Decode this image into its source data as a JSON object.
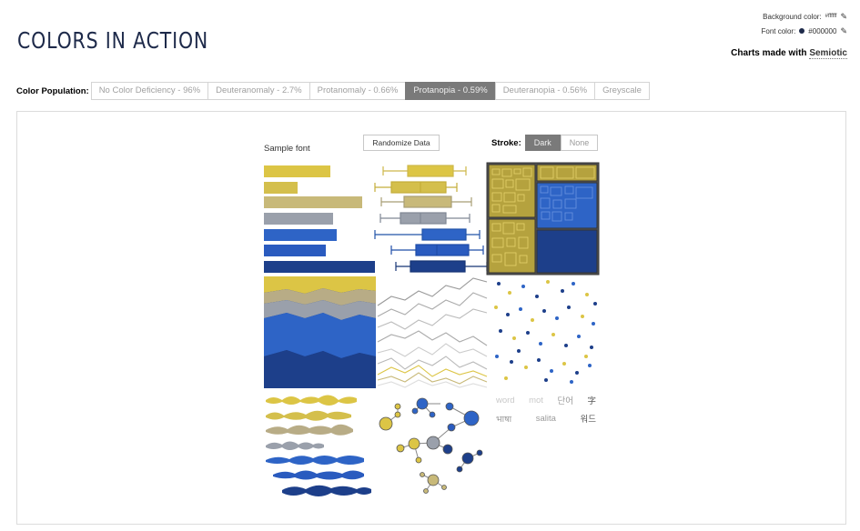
{
  "header": {
    "title": "COLORS IN ACTION",
    "background_color_label": "Background color:",
    "background_color_value": "#ffffff",
    "font_color_label": "Font color:",
    "font_color_value": "#000000",
    "made_with_prefix": "Charts made with",
    "made_with_link": "Semiotic"
  },
  "population": {
    "label": "Color Population:",
    "options": [
      {
        "label": "No Color Deficiency - 96%"
      },
      {
        "label": "Deuteranomaly - 2.7%"
      },
      {
        "label": "Protanomaly - 0.66%"
      },
      {
        "label": "Protanopia - 0.59%"
      },
      {
        "label": "Deuteranopia - 0.56%"
      },
      {
        "label": "Greyscale"
      }
    ],
    "selected": "Protanopia - 0.59%"
  },
  "controls": {
    "sample_font": "Sample font",
    "randomize_label": "Randomize Data",
    "stroke_label": "Stroke:",
    "stroke_options": [
      "Dark",
      "None"
    ],
    "stroke_selected": "Dark"
  },
  "word_cloud": {
    "row1": [
      "word",
      "mot",
      "단어",
      "字"
    ],
    "row2": [
      "भाषा",
      "salita",
      "워드"
    ]
  },
  "palette": {
    "yellow": "#dcc545",
    "khaki": "#c8b979",
    "tan": "#b8ac86",
    "grey": "#9aa0ab",
    "blue": "#2e64c6",
    "blue2": "#2a5bbf",
    "navy": "#1d3f8a",
    "selected_segment": "#7a7a7a"
  },
  "icons": {
    "background_edit": "pencil-icon",
    "font_edit": "pencil-icon",
    "font_swatch": "color-swatch-icon"
  }
}
